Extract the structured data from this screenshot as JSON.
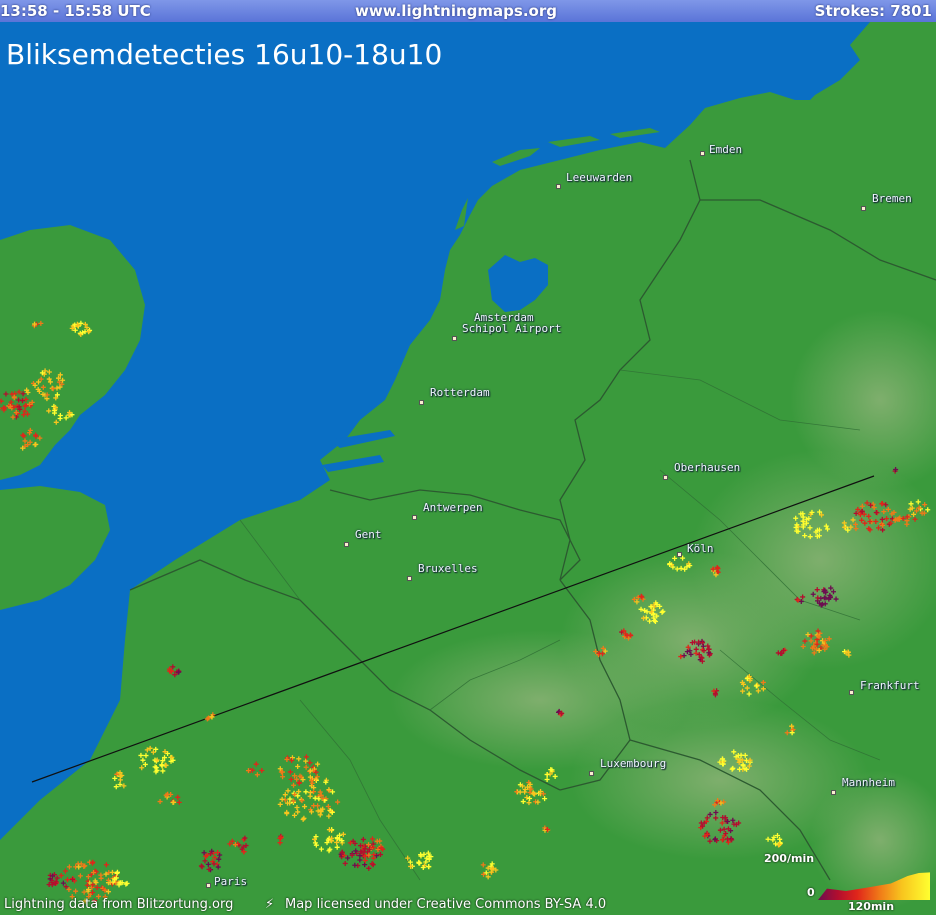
{
  "header": {
    "time_range": "13:58 - 15:58 UTC",
    "site": "www.lightningmaps.org",
    "strokes": "Strokes: 7801"
  },
  "title": "Bliksemdetecties 16u10-18u10",
  "cities": [
    {
      "name": "Emden"
    },
    {
      "name": "Leeuwarden"
    },
    {
      "name": "Bremen"
    },
    {
      "name": "Amsterdam"
    },
    {
      "name": "Schipol Airport"
    },
    {
      "name": "Rotterdam"
    },
    {
      "name": "Oberhausen"
    },
    {
      "name": "Antwerpen"
    },
    {
      "name": "Gent"
    },
    {
      "name": "Köln"
    },
    {
      "name": "Bruxelles"
    },
    {
      "name": "Frankfurt"
    },
    {
      "name": "Luxembourg"
    },
    {
      "name": "Mannheim"
    },
    {
      "name": "Paris"
    }
  ],
  "legend": {
    "rate_max": "200/min",
    "rate_min": "0",
    "time_span": "120min",
    "colors": [
      "#6d0d50",
      "#b30e2e",
      "#e0261a",
      "#f07a18",
      "#f8c51e",
      "#ffff30"
    ]
  },
  "footer": {
    "source": "Lightning data from Blitzortung.org",
    "separator": "⚡",
    "license": "Map licensed under Creative Commons BY-SA 4.0"
  },
  "colors": {
    "sea": "#0a6fc4",
    "land": "#3a9a3c",
    "highlands": "#6aa860",
    "borders": "#2c5a30",
    "header_bar": "#6a82e0"
  }
}
